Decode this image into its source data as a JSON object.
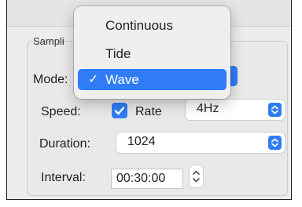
{
  "window": {
    "group_label": "Sampli"
  },
  "form": {
    "mode_label": "Mode:",
    "speed_label": "Speed:",
    "rate_checkbox_label": "Rate",
    "rate_checked": true,
    "rate_value": "4Hz",
    "duration_label": "Duration:",
    "duration_value": "1024",
    "interval_label": "Interval:",
    "interval_value": "00:30:00"
  },
  "mode_menu": {
    "options": [
      "Continuous",
      "Tide",
      "Wave"
    ],
    "selected": "Wave",
    "check_glyph": "✓"
  },
  "colors": {
    "accent": "#2f7cf6",
    "window_bg": "#ececec",
    "panel_bg": "#e9e9e9"
  },
  "icons": {
    "popup_stepper": "chevron-updown-icon",
    "checkbox": "checkmark-icon",
    "stepper": "chevron-updown-icon"
  }
}
